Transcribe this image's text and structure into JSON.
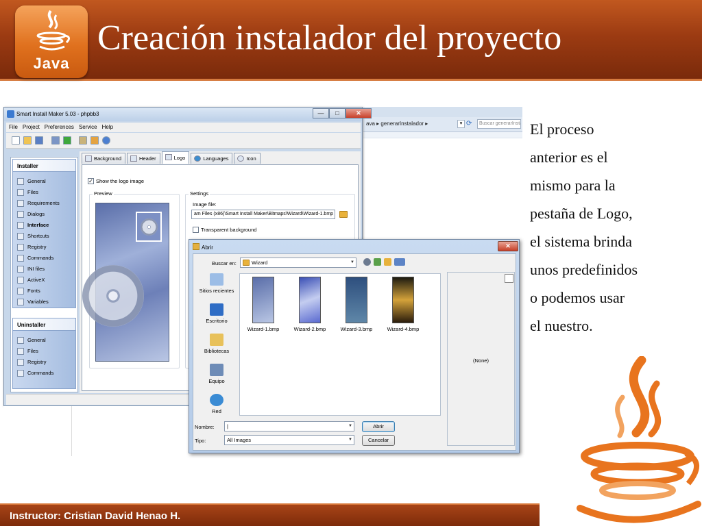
{
  "slide": {
    "title": "Creación instalador del proyecto",
    "logo_word": "Java",
    "body_lines": [
      "El proceso",
      "anterior es el",
      "mismo para la",
      "pestaña de Logo,",
      "el sistema brinda",
      "unos predefinidos",
      "o podemos usar",
      "el nuestro."
    ],
    "footer": "Instructor: Cristian David Henao H."
  },
  "explorer": {
    "breadcrumb": "ava ▸ generarInstalador ▸",
    "search_placeholder": "Buscar generarInsta"
  },
  "app": {
    "title": "Smart Install Maker 5.03 - phpbb3",
    "window_buttons": [
      "—",
      "□",
      "✕"
    ],
    "menu": [
      "File",
      "Project",
      "Preferences",
      "Service",
      "Help"
    ],
    "sidebar": {
      "installer_title": "Installer",
      "installer_items": [
        "General",
        "Files",
        "Requirements",
        "Dialogs",
        "Interface",
        "Shortcuts",
        "Registry",
        "Commands",
        "INI files",
        "ActiveX",
        "Fonts",
        "Variables"
      ],
      "uninstaller_title": "Uninstaller",
      "uninstaller_items": [
        "General",
        "Files",
        "Registry",
        "Commands"
      ]
    },
    "tabs": [
      "Background",
      "Header",
      "Logo",
      "Languages",
      "Icon"
    ],
    "selected_tab": "Logo",
    "show_logo_label": "Show the logo image",
    "show_logo_checked": true,
    "preview_label": "Preview",
    "settings_label": "Settings",
    "image_file_label": "Image file:",
    "image_file_value": "am Files (x86)\\Smart Install Maker\\Bitmaps\\Wizard\\Wizard-1.bmp",
    "transparent_label": "Transparent background",
    "transparent_checked": false
  },
  "dialog": {
    "title": "Abrir",
    "look_in_label": "Buscar en:",
    "look_in_value": "Wizard",
    "places": [
      "Sitios recientes",
      "Escritorio",
      "Bibliotecas",
      "Equipo",
      "Red"
    ],
    "files": [
      "Wizard-1.bmp",
      "Wizard-2.bmp",
      "Wizard-3.bmp",
      "Wizard-4.bmp"
    ],
    "preview_text": "(None)",
    "filename_label": "Nombre:",
    "filename_value": "|",
    "filetype_label": "Tipo:",
    "filetype_value": "All Images",
    "open_button": "Abrir",
    "cancel_button": "Cancelar"
  }
}
